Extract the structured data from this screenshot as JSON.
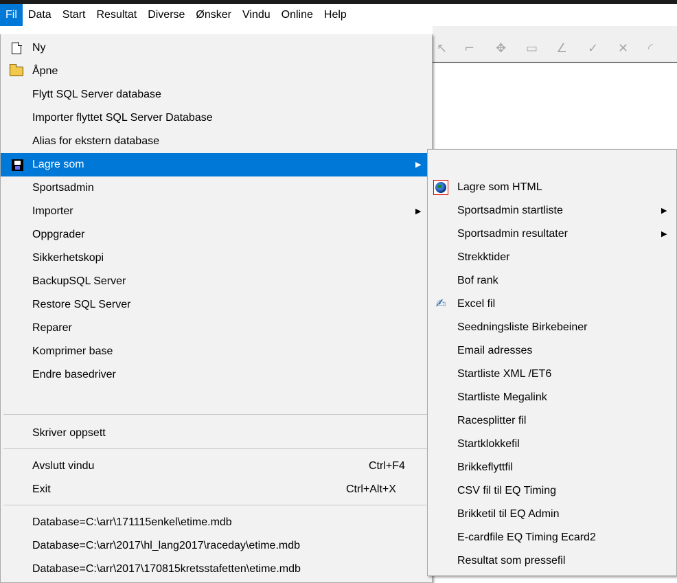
{
  "menubar": {
    "items": [
      {
        "label": "Fil"
      },
      {
        "label": "Data"
      },
      {
        "label": "Start"
      },
      {
        "label": "Resultat"
      },
      {
        "label": "Diverse"
      },
      {
        "label": "Ønsker"
      },
      {
        "label": "Vindu"
      },
      {
        "label": "Online"
      },
      {
        "label": "Help"
      }
    ]
  },
  "file_menu": {
    "new": {
      "label": "Ny",
      "icon": "new-document-icon"
    },
    "open": {
      "label": "Åpne",
      "icon": "open-folder-icon"
    },
    "move_sql": {
      "label": "Flytt SQL Server database"
    },
    "import_sql": {
      "label": "Importer flyttet SQL Server Database"
    },
    "alias": {
      "label": "Alias for ekstern database"
    },
    "save_as": {
      "label": "Lagre som",
      "icon": "floppy-disk-icon"
    },
    "sportsadmin": {
      "label": "Sportsadmin"
    },
    "import": {
      "label": "Importer"
    },
    "upgrade": {
      "label": "Oppgrader"
    },
    "backup": {
      "label": "Sikkerhetskopi"
    },
    "backup_sql": {
      "label": "BackupSQL Server"
    },
    "restore_sql": {
      "label": "Restore SQL Server"
    },
    "repair": {
      "label": "Reparer"
    },
    "compress": {
      "label": "Komprimer base"
    },
    "change_driver": {
      "label": "Endre basedriver"
    },
    "printer_setup": {
      "label": "Skriver oppsett"
    },
    "close_window": {
      "label": "Avslutt vindu",
      "shortcut": "Ctrl+F4"
    },
    "exit": {
      "label": "Exit",
      "shortcut": "Ctrl+Alt+X"
    },
    "recent": [
      {
        "label": "Database=C:\\arr\\171115enkel\\etime.mdb"
      },
      {
        "label": "Database=C:\\arr\\2017\\hl_lang2017\\raceday\\etime.mdb"
      },
      {
        "label": "Database=C:\\arr\\2017\\170815kretsstafetten\\etime.mdb"
      }
    ]
  },
  "save_as_menu": {
    "items": [
      {
        "label": "Lagre som HTML",
        "icon": "globe-icon"
      },
      {
        "label": "Sportsadmin startliste"
      },
      {
        "label": "Sportsadmin resultater"
      },
      {
        "label": "Strekktider"
      },
      {
        "label": "Bof rank"
      },
      {
        "label": "Excel fil",
        "icon": "excel-icon"
      },
      {
        "label": "Seedningsliste Birkebeiner"
      },
      {
        "label": "Email adresses"
      },
      {
        "label": "Startliste XML /ET6"
      },
      {
        "label": "Startliste Megalink"
      },
      {
        "label": "Racesplitter fil"
      },
      {
        "label": "Startklokkefil"
      },
      {
        "label": "Brikkeflyttfil"
      },
      {
        "label": "CSV fil til EQ Timing"
      },
      {
        "label": "Brikketil til EQ Admin"
      },
      {
        "label": "E-cardfile EQ Timing Ecard2"
      },
      {
        "label": "Resultat som pressefil"
      }
    ]
  },
  "colors": {
    "highlight": "#0078d7",
    "menu_bg": "#f2f2f2",
    "separator": "#c8c8c8"
  }
}
